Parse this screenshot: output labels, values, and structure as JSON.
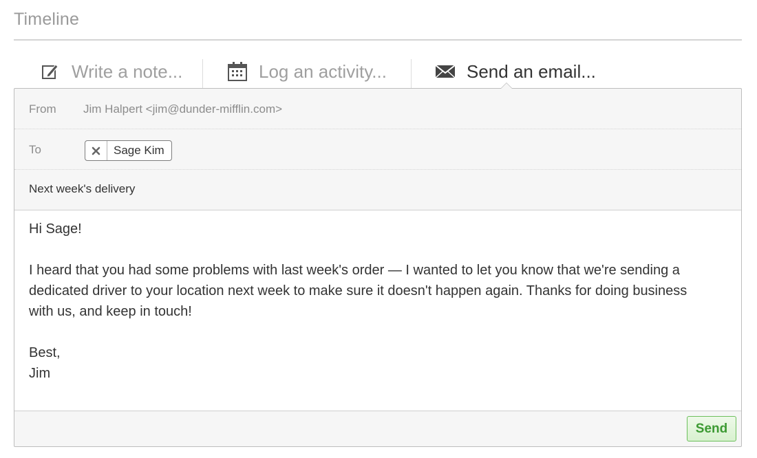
{
  "section": {
    "title": "Timeline"
  },
  "tabs": [
    {
      "label": "Write a note...",
      "icon": "pencil-icon",
      "active": false
    },
    {
      "label": "Log an activity...",
      "icon": "calendar-icon",
      "active": false
    },
    {
      "label": "Send an email...",
      "icon": "envelope-icon",
      "active": true
    }
  ],
  "email": {
    "from_label": "From",
    "from_value": "Jim Halpert <jim@dunder-mifflin.com>",
    "to_label": "To",
    "recipients": [
      {
        "name": "Sage Kim"
      }
    ],
    "subject": "Next week's delivery",
    "body_lines": [
      "Hi Sage!",
      "",
      "I heard that you had some problems with last week's order — I wanted to let you know that we're sending a",
      "dedicated driver to your location next week to make sure it doesn't happen again. Thanks for doing business",
      "with us, and keep in touch!",
      "",
      "Best,",
      "Jim"
    ],
    "send_label": "Send"
  },
  "colors": {
    "send_green": "#3c9a32",
    "muted_text": "#9f9f9f",
    "border": "#bdbdbd"
  }
}
